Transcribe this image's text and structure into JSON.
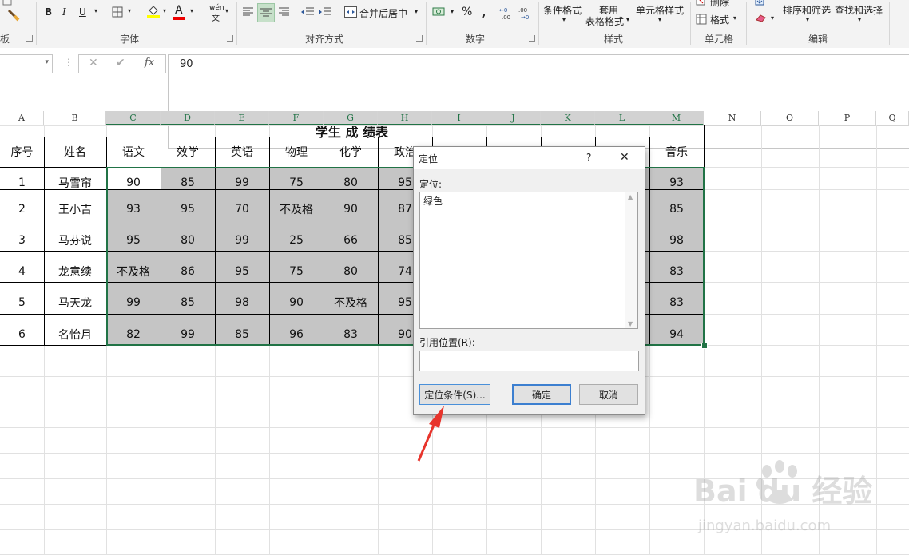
{
  "ribbon": {
    "clipboard_label": "板",
    "font_label": "字体",
    "font_buttons": {
      "bold": "B",
      "italic": "I",
      "underline": "U",
      "font_color": "A"
    },
    "phonetic": {
      "top": "wén",
      "bottom": "文"
    },
    "alignment_label": "对齐方式",
    "merge_label": "合并后居中",
    "number_label": "数字",
    "percent": "%",
    "comma": ",",
    "styles": {
      "conditional": "条件格式",
      "table_top": "套用",
      "table_bottom": "表格格式",
      "cell_styles": "单元格样式",
      "label": "样式"
    },
    "cells": {
      "delete": "删除",
      "format": "格式",
      "label": "单元格"
    },
    "editing": {
      "sort": "排序和筛选",
      "find": "查找和选择",
      "label": "编辑"
    }
  },
  "formula_bar": {
    "formula_value": "90",
    "fx": "fx"
  },
  "columns": [
    "A",
    "B",
    "C",
    "D",
    "E",
    "F",
    "G",
    "H",
    "I",
    "J",
    "K",
    "L",
    "M",
    "N",
    "O",
    "P",
    "Q"
  ],
  "sheet": {
    "title": "学生 成 绩表",
    "headers": [
      "序号",
      "姓名",
      "语文",
      "效学",
      "英语",
      "物理",
      "化学",
      "政治",
      "",
      "",
      "",
      "",
      "音乐"
    ],
    "rows": [
      {
        "no": "1",
        "name": "马雪帘",
        "chinese": "90",
        "math": "85",
        "english": "99",
        "physics": "75",
        "chemistry": "80",
        "politics": "95",
        "music": "93"
      },
      {
        "no": "2",
        "name": "王小吉",
        "chinese": "93",
        "math": "95",
        "english": "70",
        "physics": "不及格",
        "chemistry": "90",
        "politics": "87",
        "music": "85"
      },
      {
        "no": "3",
        "name": "马芬说",
        "chinese": "95",
        "math": "80",
        "english": "99",
        "physics": "25",
        "chemistry": "66",
        "politics": "85",
        "music": "98"
      },
      {
        "no": "4",
        "name": "龙意续",
        "chinese": "不及格",
        "math": "86",
        "english": "95",
        "physics": "75",
        "chemistry": "80",
        "politics": "74",
        "music": "83"
      },
      {
        "no": "5",
        "name": "马天龙",
        "chinese": "99",
        "math": "85",
        "english": "98",
        "physics": "90",
        "chemistry": "不及格",
        "politics": "95",
        "music": "83"
      },
      {
        "no": "6",
        "name": "名怡月",
        "chinese": "82",
        "math": "99",
        "english": "85",
        "physics": "96",
        "chemistry": "83",
        "politics": "90",
        "music": "94"
      }
    ]
  },
  "dialog": {
    "title": "定位",
    "help": "?",
    "close": "✕",
    "goto_label": "定位:",
    "list_items": [
      "绿色"
    ],
    "reference_label": "引用位置(R):",
    "reference_value": "",
    "special_button": "定位条件(S)...",
    "ok_button": "确定",
    "cancel_button": "取消"
  },
  "watermark": {
    "brand": "Bai du 经验",
    "url": "jingyan.baidu.com"
  },
  "colors": {
    "accent": "#217346",
    "selection_fill": "#c5c5c5",
    "arrow": "#e8342c"
  }
}
